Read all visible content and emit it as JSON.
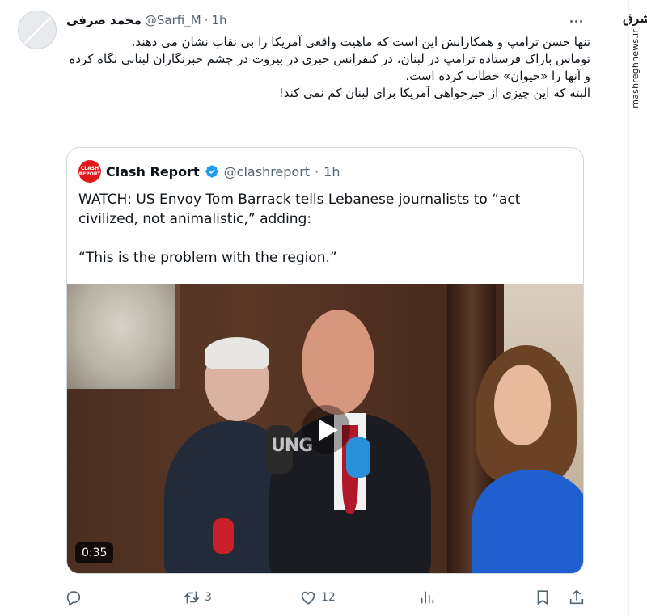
{
  "tweet": {
    "display_name": "محمد صرفی",
    "handle": "@Sarfi_M",
    "dot": "·",
    "time": "1h",
    "text_lines": [
      "تنها حسن ترامپ و همکارانش این است که ماهیت واقعی آمریکا را بی نقاب نشان می دهند.",
      "توماس باراک فرستاده ترامپ در لبنان، در کنفرانس خبری در بیروت در چشم خبرنگاران لبنانی نگاه کرده و آنها را «حیوان» خطاب کرده است.",
      "البته که این چیزی از خیرخواهی آمریکا برای لبنان کم نمی کند!"
    ]
  },
  "quote": {
    "avatar_text": "CLASH REPORT",
    "name": "Clash Report",
    "handle": "@clashreport",
    "dot": "·",
    "time": "1h",
    "text_line1": "WATCH: US Envoy Tom Barrack tells Lebanese journalists to “act civilized, not animalistic,” adding:",
    "text_line2": "“This is the problem with the region.”",
    "video": {
      "duration": "0:35",
      "watermark": "UNG"
    }
  },
  "actions": {
    "reply_count": "",
    "retweet_count": "3",
    "like_count": "12"
  },
  "watermark": {
    "logo": "مشرق",
    "url": "mashreghnews.ir"
  },
  "colors": {
    "text": "#0f1419",
    "muted": "#536471",
    "border": "#cfd9de",
    "verified": "#1d9bf0",
    "clash_red": "#e0191b"
  }
}
